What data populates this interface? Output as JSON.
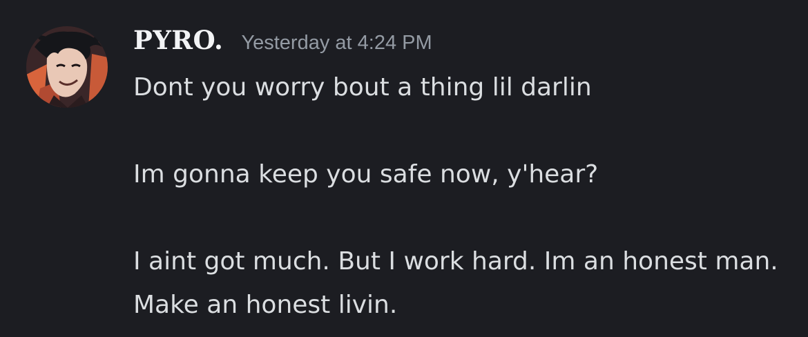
{
  "message": {
    "username": "PYRO.",
    "timestamp": "Yesterday at 4:24 PM",
    "avatar_icon": "user-avatar-icon",
    "lines": [
      "Dont you worry bout a thing lil darlin",
      "Im gonna keep you safe now, y'hear?",
      "I aint got much. But I work hard. Im an honest man. Make an honest livin."
    ]
  },
  "colors": {
    "background": "#1c1d22",
    "username": "#f2f3f5",
    "timestamp": "#949ba4",
    "text": "#dbdee1"
  }
}
